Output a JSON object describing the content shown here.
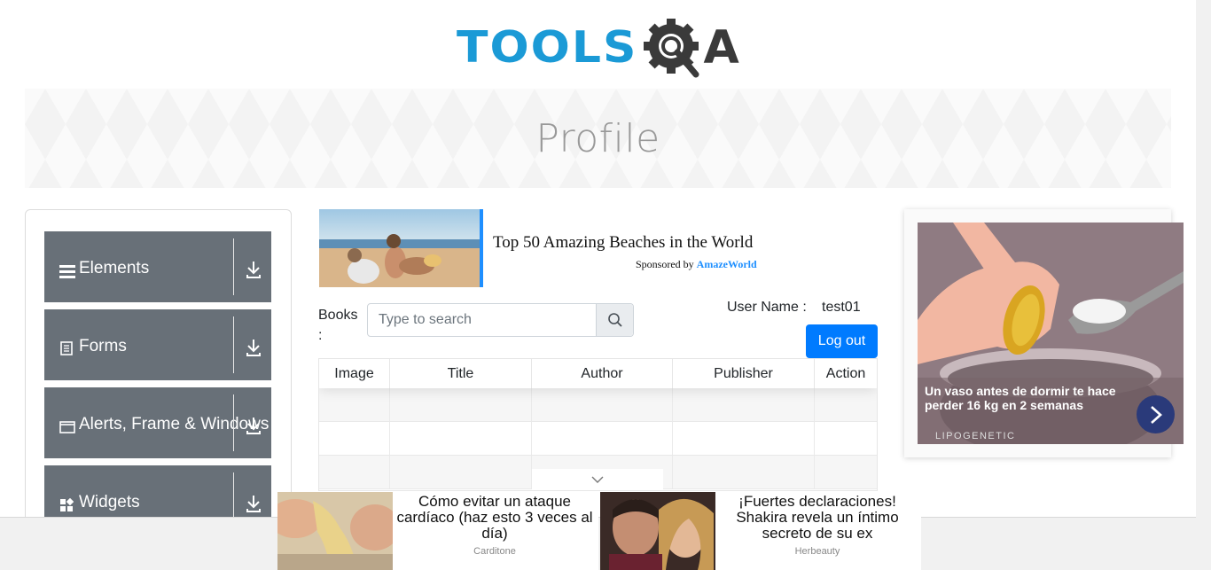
{
  "header": {
    "logo_text": "TOOLS",
    "logo_suffix": "A",
    "logo_name": "ToolsQA logo"
  },
  "banner": {
    "title": "Profile"
  },
  "sidebar": {
    "groups": [
      {
        "label": "Elements",
        "icon": "hamburger-icon"
      },
      {
        "label": "Forms",
        "icon": "document-icon"
      },
      {
        "label": "Alerts, Frame & Windows",
        "icon": "window-icon"
      },
      {
        "label": "Widgets",
        "icon": "widgets-icon"
      }
    ]
  },
  "ad_top": {
    "title": "Top 50 Amazing Beaches in the World",
    "sponsored_prefix": "Sponsored by",
    "sponsor": "AmazeWorld"
  },
  "books": {
    "label": "Books :",
    "search_placeholder": "Type to search"
  },
  "user": {
    "label": "User Name :",
    "value": "test01",
    "logout_label": "Log out"
  },
  "table": {
    "columns": [
      "Image",
      "Title",
      "Author",
      "Publisher",
      "Action"
    ],
    "rows": [
      [
        "",
        "",
        "",
        "",
        ""
      ],
      [
        "",
        "",
        "",
        "",
        ""
      ],
      [
        "",
        "",
        "",
        "",
        ""
      ]
    ]
  },
  "ad_right": {
    "caption": "Un vaso antes de dormir te hace perder 16 kg en 2 semanas",
    "brand": "LIPOGENETIC"
  },
  "ad_bottom": [
    {
      "title": "Cómo evitar un ataque cardíaco (haz esto 3 veces al día)",
      "source": "Carditone"
    },
    {
      "title": "¡Fuertes declaraciones! Shakira revela un íntimo secreto de su ex",
      "source": "Herbeauty"
    }
  ],
  "colors": {
    "brand_blue": "#1b9ad6",
    "sidebar_group": "#687078",
    "primary_button": "#007bff",
    "sponsor_link": "#1e8fff"
  }
}
